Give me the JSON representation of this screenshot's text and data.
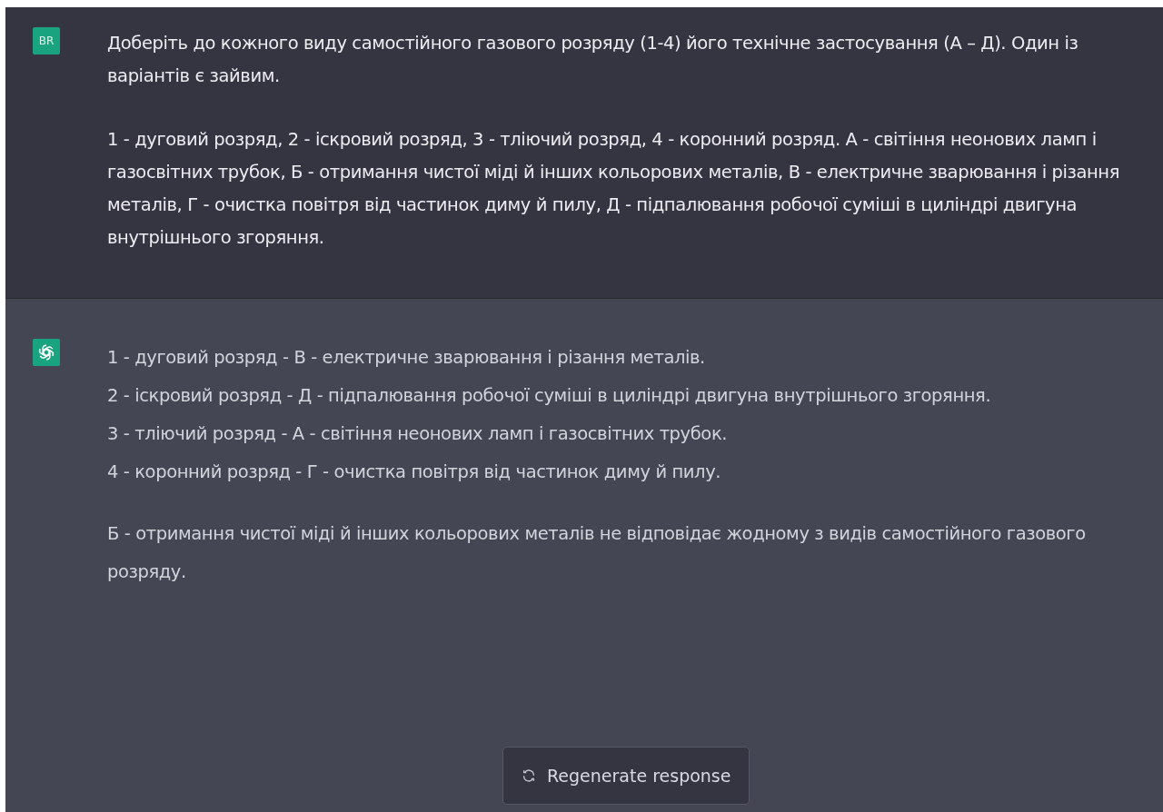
{
  "messages": [
    {
      "kind": "user",
      "avatar": "BR",
      "paragraphs": [
        "Доберіть до кожного виду самостійного газового розряду (1-4) його технічне застосування (А – Д). Один із варіантів є зайвим.",
        "1 - дуговий розряд, 2 - іскровий розряд, 3 - тліючий розряд, 4 - коронний розряд. А - світіння неонових ламп і газосвітних трубок, Б - отримання чистої міді й інших кольорових металів, В - електричне зварювання і різання металів, Г - очистка повітря від частинок диму й пилу, Д - підпалювання робочої суміші в циліндрі двигуна внутрішнього згоряння."
      ]
    },
    {
      "kind": "assistant",
      "paragraphs": [
        "1 - дуговий розряд - В - електричне зварювання і різання металів.\n2 - іскровий розряд - Д - підпалювання робочої суміші в циліндрі двигуна внутрішнього згоряння.\n3 - тліючий розряд - А - світіння неонових ламп і газосвітних трубок.\n4 - коронний розряд - Г - очистка повітря від частинок диму й пилу.",
        "Б - отримання чистої міді й інших кольорових металів не відповідає жодному з видів самостійного газового розряду."
      ]
    }
  ],
  "regenerate_button": {
    "label": "Regenerate response"
  }
}
